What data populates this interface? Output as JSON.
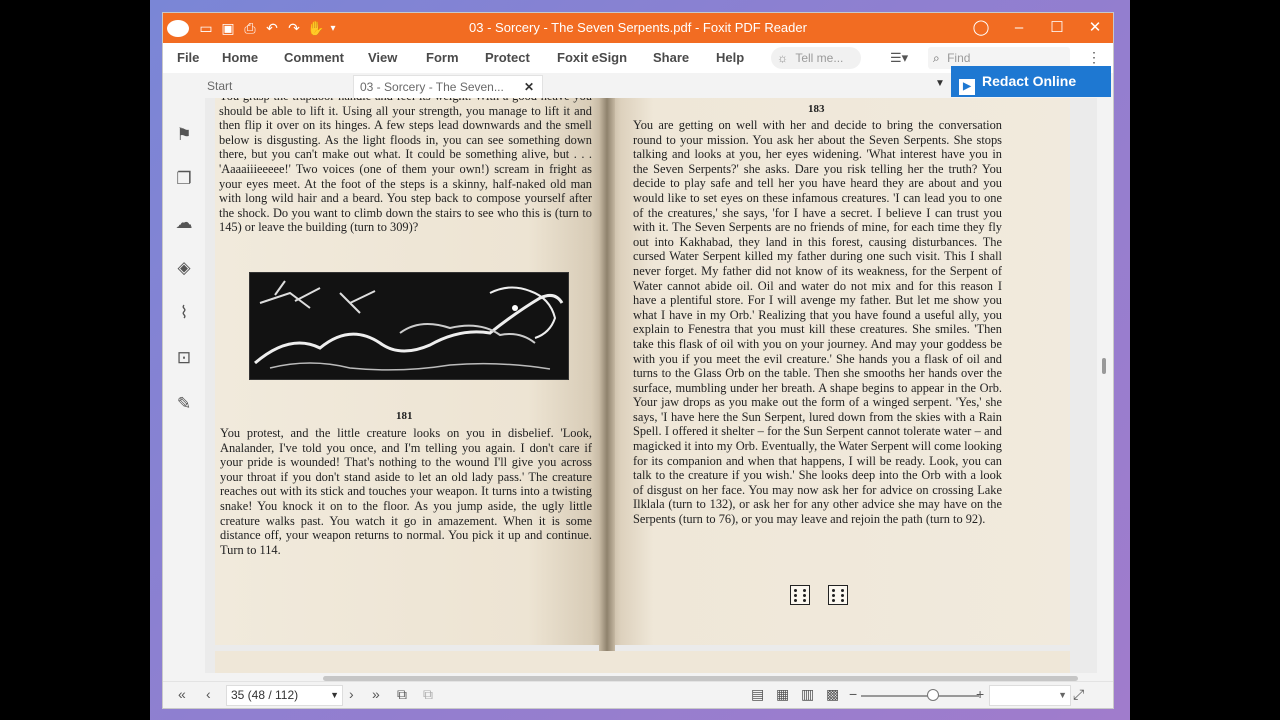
{
  "window": {
    "title": "03 - Sorcery - The Seven Serpents.pdf - Foxit PDF Reader",
    "accent": "#f26c22",
    "controls": {
      "minimize": "–",
      "maximize": "☐",
      "close": "✕"
    }
  },
  "menu": {
    "items": [
      "File",
      "Home",
      "Comment",
      "View",
      "Form",
      "Protect",
      "Foxit eSign",
      "Share",
      "Help"
    ],
    "tellme_placeholder": "Tell me...",
    "find_placeholder": "Find"
  },
  "tabs": {
    "start": "Start",
    "document": "03 - Sorcery - The Seven...",
    "close": "✕"
  },
  "redact_button": {
    "label": "Redact Online",
    "color": "#1e78d2"
  },
  "sidebar_icons": [
    "bookmark-icon",
    "pages-icon",
    "comment-icon",
    "layers-icon",
    "attachment-icon",
    "security-icon",
    "signature-icon"
  ],
  "book": {
    "left_top_text": "You grasp the trapdoor handle and feel its weight. With a good heave you should be able to lift it. Using all your strength, you manage to lift it and then flip it over on its hinges. A few steps lead downwards and the smell below is disgusting. As the light floods in, you can see something down there, but you can't make out what. It could be something alive, but . . . 'Aaaaiiieeeee!' Two voices (one of them your own!) scream in fright as your eyes meet. At the foot of the steps is a skinny, half-naked old man with long wild hair and a beard. You step back to compose yourself after the shock. Do you want to climb down the stairs to see who this is (turn to 145) or leave the building (turn to 309)?",
    "left_section_number": "181",
    "left_section_text": "You protest, and the little creature looks on you in disbelief. 'Look, Analander, I've told you once, and I'm telling you again. I don't care if your pride is wounded! That's nothing to the wound I'll give you across your throat if you don't stand aside to let an old lady pass.' The creature reaches out with its stick and touches your weapon. It turns into a twisting snake! You knock it on to the floor. As you jump aside, the ugly little creature walks past. You watch it go in amazement. When it is some distance off, your weapon returns to normal. You pick it up and continue. Turn to 114.",
    "right_section_number": "183",
    "right_section_text": "You are getting on well with her and decide to bring the conversation round to your mission. You ask her about the Seven Serpents. She stops talking and looks at you, her eyes widening. 'What interest have you in the Seven Serpents?' she asks. Dare you risk telling her the truth? You decide to play safe and tell her you have heard they are about and you would like to set eyes on these infamous creatures. 'I can lead you to one of the creatures,' she says, 'for I have a secret. I believe I can trust you with it. The Seven Serpents are no friends of mine, for each time they fly out into Kakhabad, they land in this forest, causing disturbances. The cursed Water Serpent killed my father during one such visit. This I shall never forget. My father did not know of its weakness, for the Serpent of Water cannot abide oil. Oil and water do not mix and for this reason I have a plentiful store. For I will avenge my father. But let me show you what I have in my Orb.' Realizing that you have found a useful ally, you explain to Fenestra that you must kill these creatures. She smiles. 'Then take this flask of oil with you on your journey. And may your goddess be with you if you meet the evil creature.' She hands you a flask of oil and turns to the Glass Orb on the table. Then she smooths her hands over the surface, mumbling under her breath. A shape begins to appear in the Orb. Your jaw drops as you make out the form of a winged serpent. 'Yes,' she says, 'I have here the Sun Serpent, lured down from the skies with a Rain Spell. I offered it shelter – for the Sun Serpent cannot tolerate water – and magicked it into my Orb. Eventually, the Water Serpent will come looking for its companion and when that happens, I will be ready. Look, you can talk to the creature if you wish.' She looks deep into the Orb with a look of disgust on her face. You may now ask her for advice on crossing Lake Ilklala (turn to 132), or ask her for any other advice she may have on the Serpents (turn to 76), or you may leave and rejoin the path (turn to 92)."
  },
  "status": {
    "page_field": "35 (48 / 112)",
    "zoom_field": "",
    "zoom_level": 0.6
  }
}
